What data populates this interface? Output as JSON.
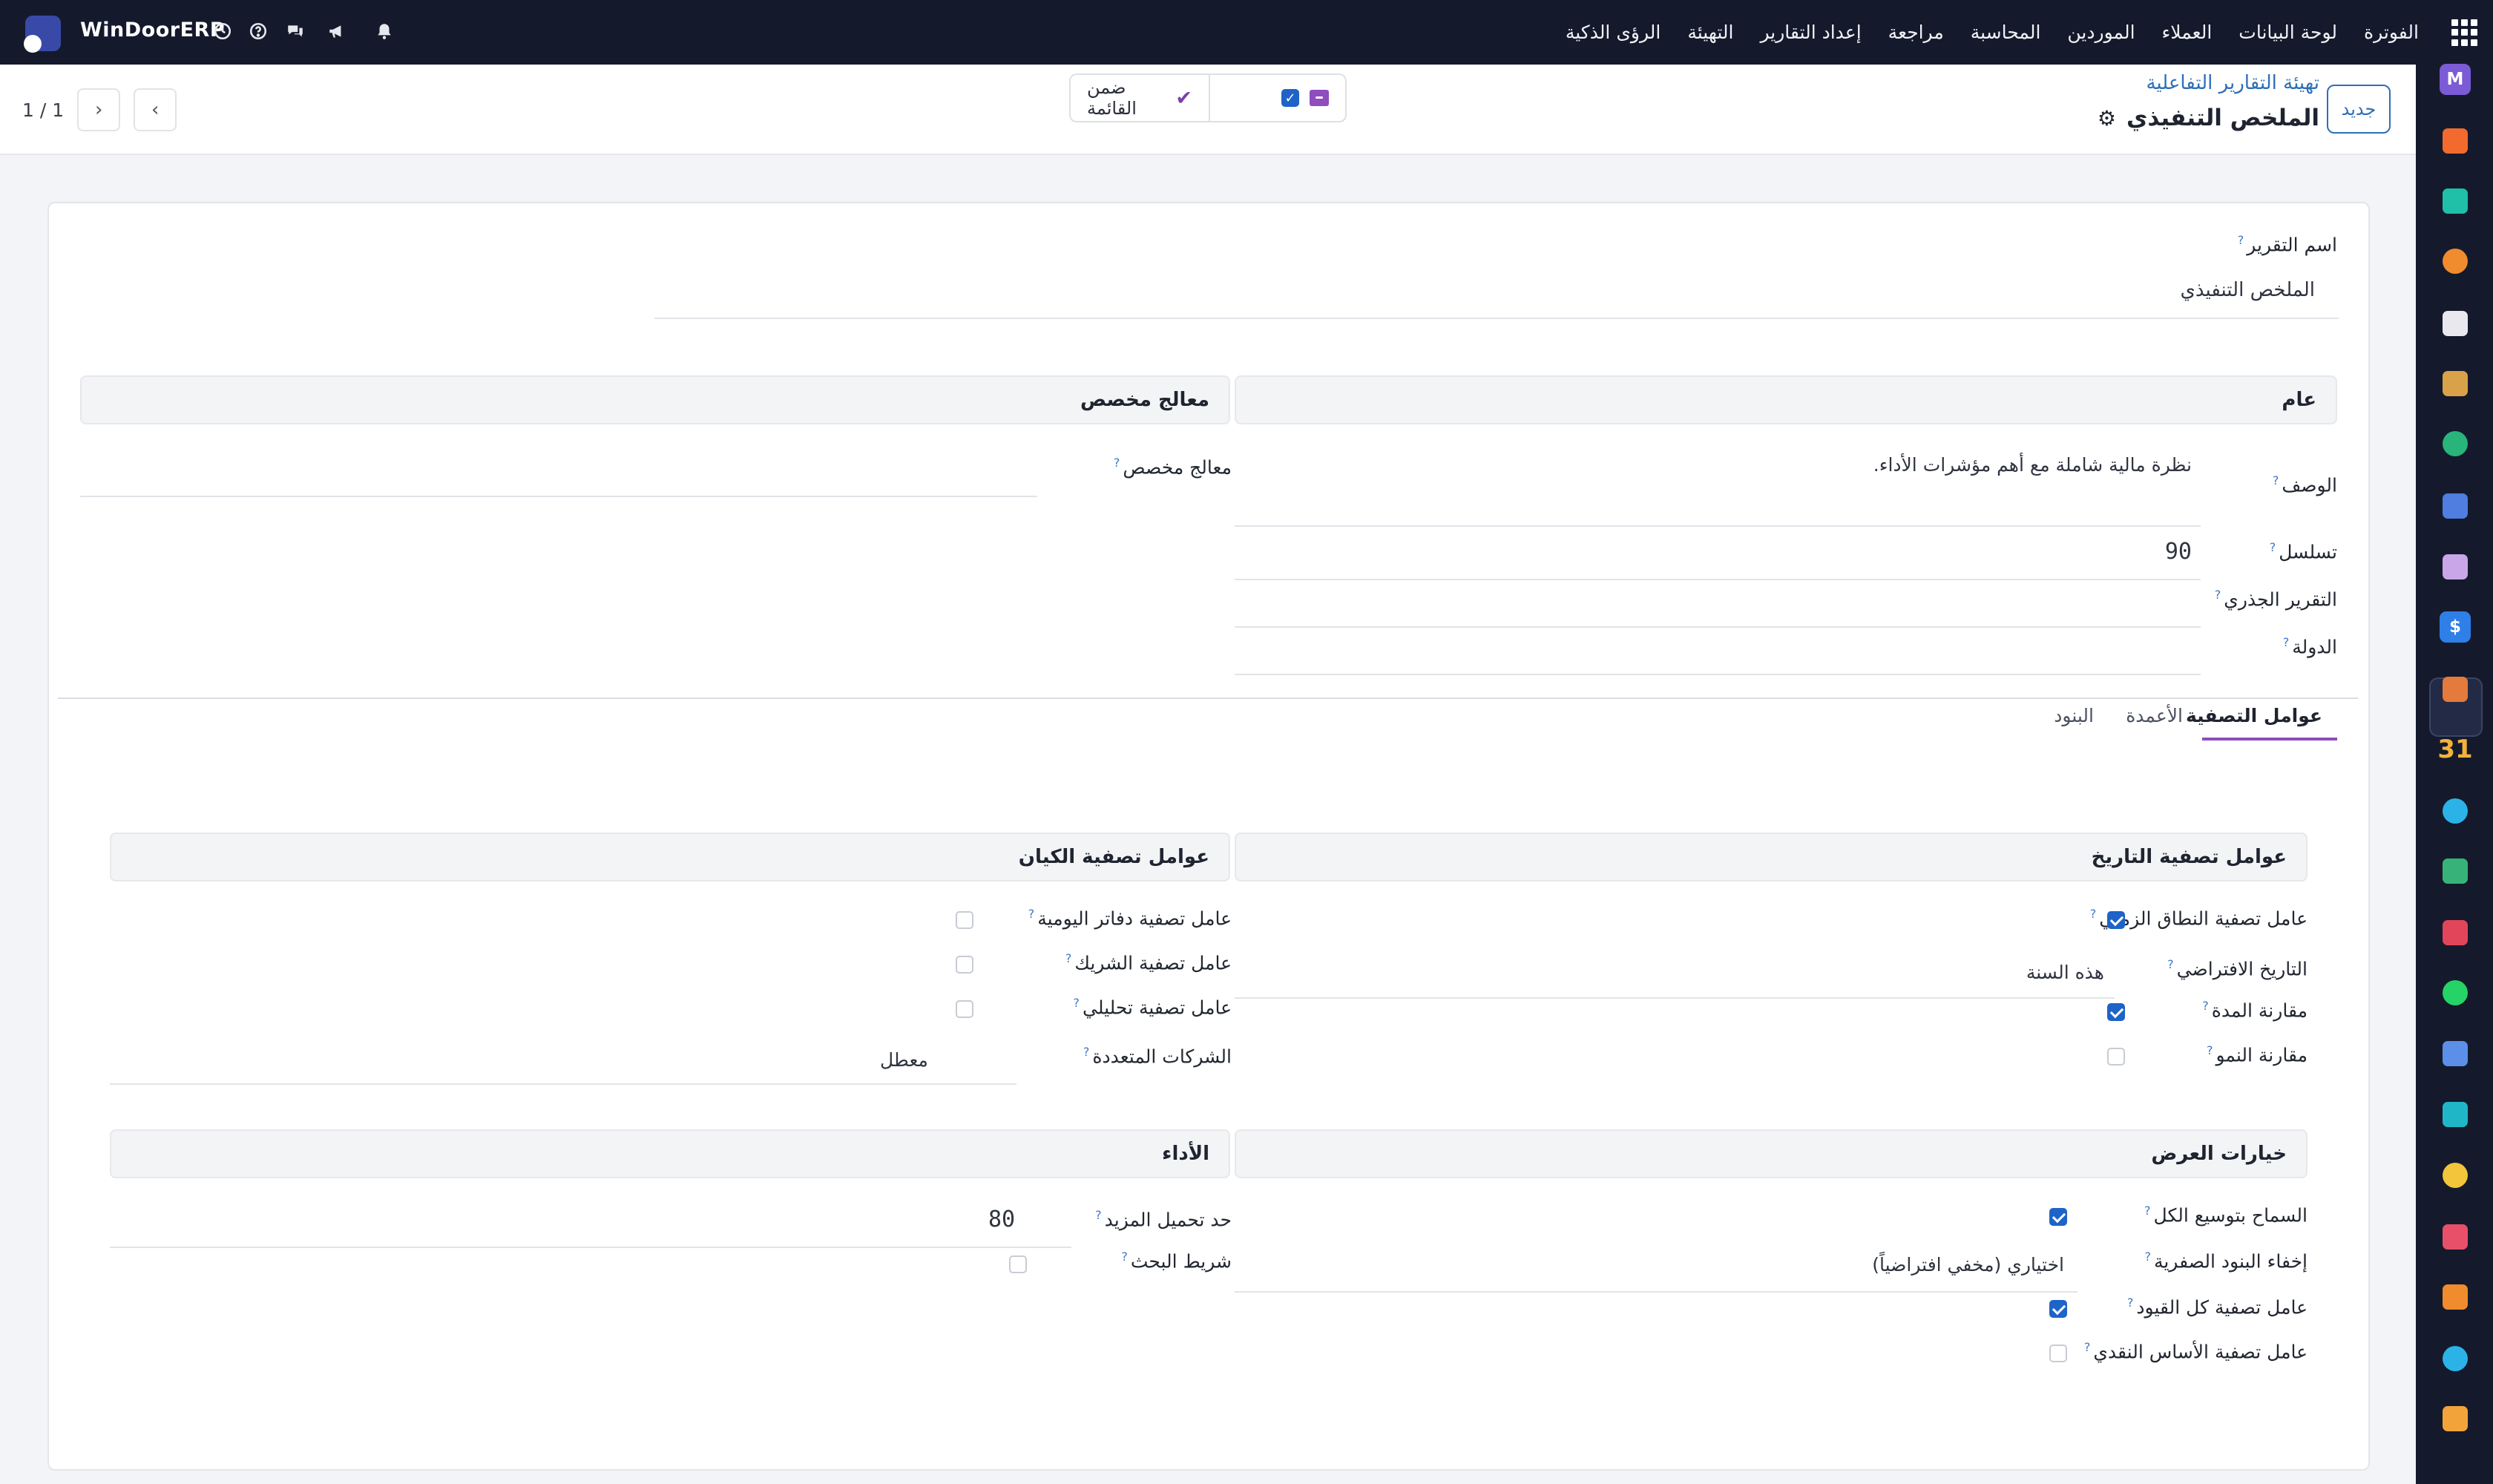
{
  "topbar": {
    "brand": "WinDoorERP",
    "menu": [
      "الفوترة",
      "لوحة البيانات",
      "العملاء",
      "الموردين",
      "المحاسبة",
      "مراجعة",
      "إعداد التقارير",
      "التهيئة",
      "الرؤى الذكية"
    ]
  },
  "dock": {
    "apps": [
      {
        "icon": "m-app-icon",
        "color": "#7b5bd6",
        "text": "M"
      },
      {
        "icon": "chat-bubble-icon",
        "color": "#f26a2e",
        "text": ""
      },
      {
        "icon": "vee-icon",
        "color": "#1fbfa8",
        "text": ""
      },
      {
        "icon": "bar-chart-icon",
        "color": "#f08b2e",
        "text": ""
      },
      {
        "icon": "cube-icon",
        "color": "#e8e8ee",
        "text": ""
      },
      {
        "icon": "photo-icon",
        "color": "#d9a24a",
        "text": ""
      },
      {
        "icon": "check-icon",
        "color": "#28b47b",
        "text": ""
      },
      {
        "icon": "book-icon",
        "color": "#4f7de0",
        "text": ""
      },
      {
        "icon": "box-icon",
        "color": "#c9a6e8",
        "text": ""
      },
      {
        "icon": "invoice-icon",
        "color": "#2f7fe8",
        "text": "$"
      },
      {
        "icon": "people-icon",
        "color": "#e47a3c",
        "text": ""
      },
      {
        "icon": "calendar-icon",
        "color": "#f3b23a",
        "text": "31"
      },
      {
        "icon": "pen-icon",
        "color": "#2bb3e8",
        "text": ""
      },
      {
        "icon": "contact-icon",
        "color": "#37b37a",
        "text": ""
      },
      {
        "icon": "dashboard-icon",
        "color": "#e2455a",
        "text": ""
      },
      {
        "icon": "whatsapp-icon",
        "color": "#25d366",
        "text": ""
      },
      {
        "icon": "clock-icon",
        "color": "#5b8fe8",
        "text": ""
      },
      {
        "icon": "wave-icon",
        "color": "#1fb7c8",
        "text": ""
      },
      {
        "icon": "paper-plane-icon",
        "color": "#f2c53a",
        "text": ""
      },
      {
        "icon": "stripes-icon",
        "color": "#e8506a",
        "text": ""
      },
      {
        "icon": "hex-icon",
        "color": "#f08b2e",
        "text": ""
      },
      {
        "icon": "pie-icon",
        "color": "#2bb3e8",
        "text": ""
      },
      {
        "icon": "hexagon-icon",
        "color": "#f2a43a",
        "text": ""
      }
    ]
  },
  "control": {
    "new_button": "جديد",
    "breadcrumb": "تهيئة التقارير التفاعلية",
    "title": "الملخص التنفيذي",
    "in_list": "ضمن القائمة",
    "pager": "1 / 1"
  },
  "form": {
    "report_name_label": "اسم التقرير",
    "report_name_value": "الملخص التنفيذي",
    "general_head": "عام",
    "custom_handler_head": "معالج مخصص",
    "custom_handler_label": "معالج مخصص",
    "description_label": "الوصف",
    "description_value": "نظرة مالية شاملة مع أهم مؤشرات الأداء.",
    "sequence_label": "تسلسل",
    "sequence_value": "90",
    "root_report_label": "التقرير الجذري",
    "country_label": "الدولة"
  },
  "tabs": {
    "filters": "عوامل التصفية",
    "columns": "الأعمدة",
    "lines": "البنود"
  },
  "filters": {
    "date_head": "عوامل تصفية التاريخ",
    "entity_head": "عوامل تصفية الكيان",
    "date_range_label": "عامل تصفية النطاق الزمني",
    "default_date_label": "التاريخ الافتراضي",
    "default_date_value": "هذه السنة",
    "period_comparison_label": "مقارنة المدة",
    "growth_comparison_label": "مقارنة النمو",
    "journals_label": "عامل تصفية دفاتر اليومية",
    "partner_label": "عامل تصفية الشريك",
    "analytic_label": "عامل تصفية تحليلي",
    "multi_company_label": "الشركات المتعددة",
    "multi_company_value": "معطل",
    "display_head": "خيارات العرض",
    "performance_head": "الأداء",
    "unfold_all_label": "السماح بتوسيع الكل",
    "hide_zero_label": "إخفاء البنود الصفرية",
    "hide_zero_value": "اختياري (مخفي افتراضياً)",
    "all_entries_label": "عامل تصفية كل القيود",
    "cash_basis_label": "عامل تصفية الأساس النقدي",
    "load_more_label": "حد تحميل المزيد",
    "load_more_value": "80",
    "search_bar_label": "شريط البحث"
  }
}
